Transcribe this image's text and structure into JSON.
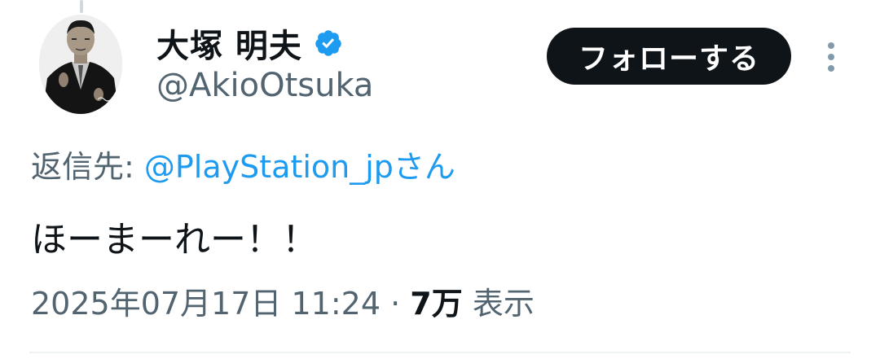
{
  "author": {
    "display_name": "大塚 明夫",
    "handle": "@AkioOtsuka",
    "verified": true
  },
  "follow_button": {
    "label": "フォローする"
  },
  "reply": {
    "prefix": "返信先: ",
    "target": "@PlayStation_jp",
    "suffix": "さん"
  },
  "tweet": {
    "text": "ほーまーれー！！"
  },
  "meta": {
    "timestamp": "2025年07月17日 11:24",
    "separator": " · ",
    "views_count": "7万",
    "views_label": "表示"
  },
  "colors": {
    "verified_badge": "#1d9bf0",
    "link": "#1d9bf0",
    "button_bg": "#0f1419",
    "secondary_text": "#536471"
  }
}
